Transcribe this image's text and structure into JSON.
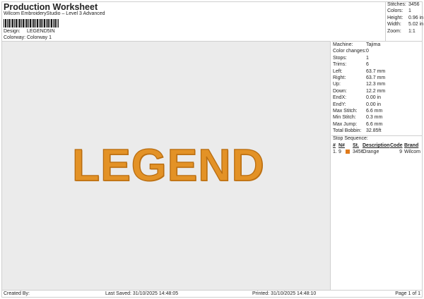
{
  "header": {
    "title": "Production Worksheet",
    "subtitle": "Wilcom EmbroideryStudio – Level 3 Advanced",
    "design_label": "Design:",
    "design": "LEGEND5IN",
    "colorway_label": "Colorway:",
    "colorway": "Colorway 1"
  },
  "summary": [
    {
      "label": "Stitches:",
      "value": "3456"
    },
    {
      "label": "Colors:",
      "value": "1"
    },
    {
      "label": "Height:",
      "value": "0.96 in"
    },
    {
      "label": "Width:",
      "value": "5.02 in"
    },
    {
      "label": "Zoom:",
      "value": "1:1"
    }
  ],
  "design_text": "LEGEND",
  "thread_color": "#e39226",
  "details": [
    {
      "label": "Machine:",
      "value": "Tajima"
    },
    {
      "label": "Color changes:",
      "value": "0"
    },
    {
      "label": "Stops:",
      "value": "1"
    },
    {
      "label": "Trims:",
      "value": "6"
    },
    {
      "label": "Left:",
      "value": "63.7 mm"
    },
    {
      "label": "Right:",
      "value": "63.7 mm"
    },
    {
      "label": "Up:",
      "value": "12.3 mm"
    },
    {
      "label": "Down:",
      "value": "12.2 mm"
    },
    {
      "label": "EndX:",
      "value": "0.00 in"
    },
    {
      "label": "EndY:",
      "value": "0.00 in"
    },
    {
      "label": "Max Stitch:",
      "value": "6.6 mm"
    },
    {
      "label": "Min Stitch:",
      "value": "0.3 mm"
    },
    {
      "label": "Max Jump:",
      "value": "6.6 mm"
    },
    {
      "label": "Total Bobbin:",
      "value": "32.85ft"
    }
  ],
  "stop_sequence": {
    "title": "Stop Sequence:",
    "columns": [
      "#",
      "N#",
      "St.",
      "Description",
      "Code",
      "Brand"
    ],
    "rows": [
      {
        "num": "1.",
        "n": "9",
        "color": "#e07a1a",
        "st": "3456",
        "description": "Orange",
        "code": "9",
        "brand": "Wilcom"
      }
    ]
  },
  "footer": {
    "created_by": "Created By:",
    "last_saved": "Last Saved: 31/10/2025 14:48:05",
    "printed": "Printed: 31/10/2025 14:48:10",
    "page": "Page 1 of 1"
  }
}
